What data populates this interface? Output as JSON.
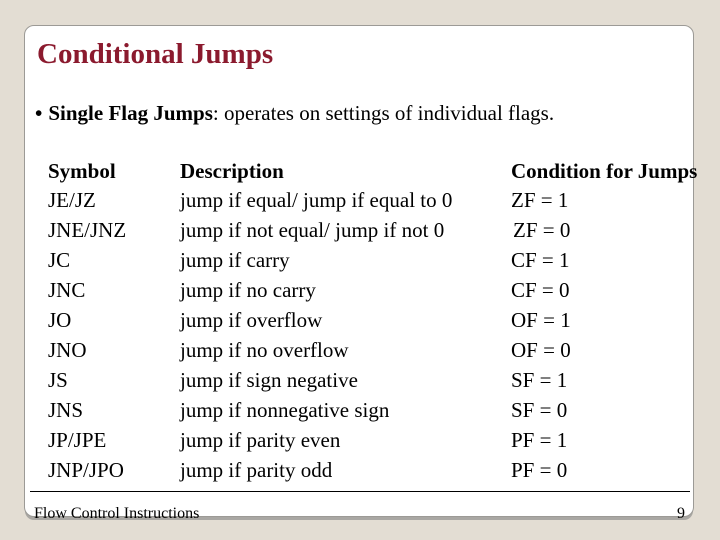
{
  "slide": {
    "title": "Conditional Jumps",
    "title_color": "#8b1a2e",
    "bullet": {
      "marker": "•",
      "term": "Single Flag Jumps",
      "text": ": operates on settings of individual flags."
    },
    "table": {
      "headers": {
        "symbol": "Symbol",
        "description": "Description",
        "condition": "Condition for Jumps"
      },
      "rows": [
        {
          "symbol": "JE/JZ",
          "description": "jump if equal/ jump if equal to 0",
          "condition": "ZF = 1"
        },
        {
          "symbol": "JNE/JNZ",
          "description": "jump if not equal/ jump if not 0",
          "condition": "ZF = 0"
        },
        {
          "symbol": "JC",
          "description": "jump if carry",
          "condition": "CF = 1"
        },
        {
          "symbol": "JNC",
          "description": "jump if no carry",
          "condition": "CF = 0"
        },
        {
          "symbol": "JO",
          "description": "jump if overflow",
          "condition": "OF = 1"
        },
        {
          "symbol": "JNO",
          "description": "jump if no overflow",
          "condition": "OF = 0"
        },
        {
          "symbol": "JS",
          "description": "jump if sign negative",
          "condition": "SF = 1"
        },
        {
          "symbol": "JNS",
          "description": "jump if nonnegative sign",
          "condition": "SF = 0"
        },
        {
          "symbol": "JP/JPE",
          "description": "jump if parity even",
          "condition": "PF = 1"
        },
        {
          "symbol": "JNP/JPO",
          "description": "jump if parity odd",
          "condition": "PF = 0"
        }
      ]
    },
    "footer": {
      "text": "Flow Control Instructions",
      "page_number": "9"
    }
  }
}
